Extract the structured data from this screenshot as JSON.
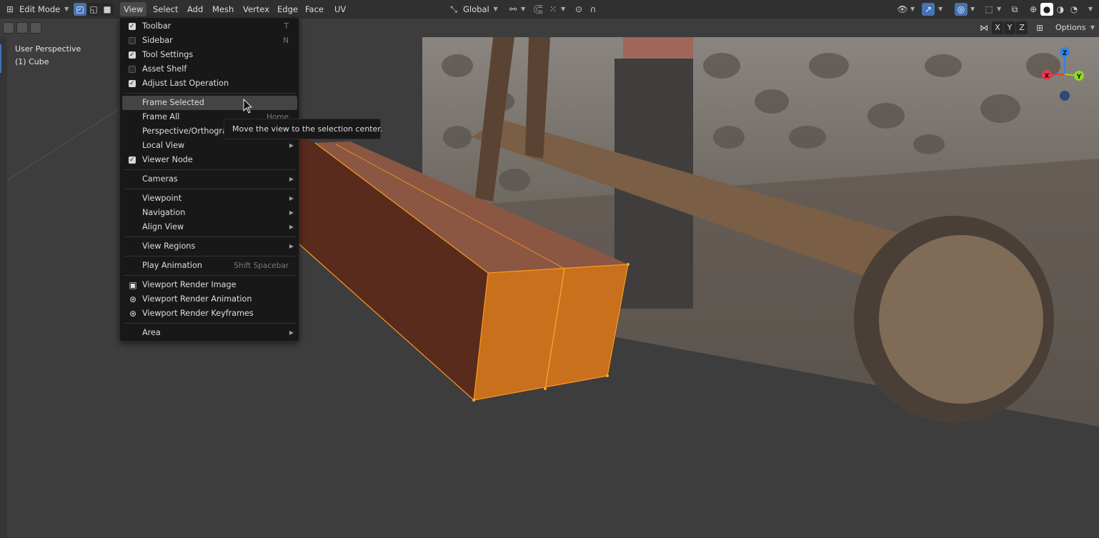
{
  "header": {
    "mode": "Edit Mode",
    "menus": [
      "View",
      "Select",
      "Add",
      "Mesh",
      "Vertex",
      "Edge",
      "Face",
      "UV"
    ],
    "transform_orientation": "Global"
  },
  "toolbar2": {
    "axes": [
      "X",
      "Y",
      "Z"
    ],
    "options_label": "Options"
  },
  "viewport": {
    "perspective_label": "User Perspective",
    "object_label": "(1) Cube"
  },
  "gizmo": {
    "x": "X",
    "y": "Y",
    "z": "Z"
  },
  "view_menu": {
    "toolbar": {
      "label": "Toolbar",
      "shortcut": "T",
      "checked": true
    },
    "sidebar": {
      "label": "Sidebar",
      "shortcut": "N",
      "checked": false
    },
    "tool_settings": {
      "label": "Tool Settings",
      "checked": true
    },
    "asset_shelf": {
      "label": "Asset Shelf",
      "checked": false
    },
    "adjust_last": {
      "label": "Adjust Last Operation",
      "checked": true
    },
    "frame_selected": {
      "label": "Frame Selected"
    },
    "frame_all": {
      "label": "Frame All",
      "shortcut": "Home"
    },
    "persp_ortho": {
      "label": "Perspective/Orthographic"
    },
    "local_view": {
      "label": "Local View"
    },
    "viewer_node": {
      "label": "Viewer Node",
      "checked": true
    },
    "cameras": {
      "label": "Cameras"
    },
    "viewpoint": {
      "label": "Viewpoint"
    },
    "navigation": {
      "label": "Navigation"
    },
    "align_view": {
      "label": "Align View"
    },
    "view_regions": {
      "label": "View Regions"
    },
    "play_animation": {
      "label": "Play Animation",
      "shortcut": "Shift Spacebar"
    },
    "render_image": {
      "label": "Viewport Render Image"
    },
    "render_animation": {
      "label": "Viewport Render Animation"
    },
    "render_keyframes": {
      "label": "Viewport Render Keyframes"
    },
    "area": {
      "label": "Area"
    }
  },
  "tooltip": "Move the view to the selection center.",
  "colors": {
    "accent": "#4772b3",
    "menu_bg": "#181818",
    "selection_orange": "#ff9a1f",
    "axis_x": "#e8384f",
    "axis_y": "#8bdc1a",
    "axis_z": "#2f86e8"
  }
}
